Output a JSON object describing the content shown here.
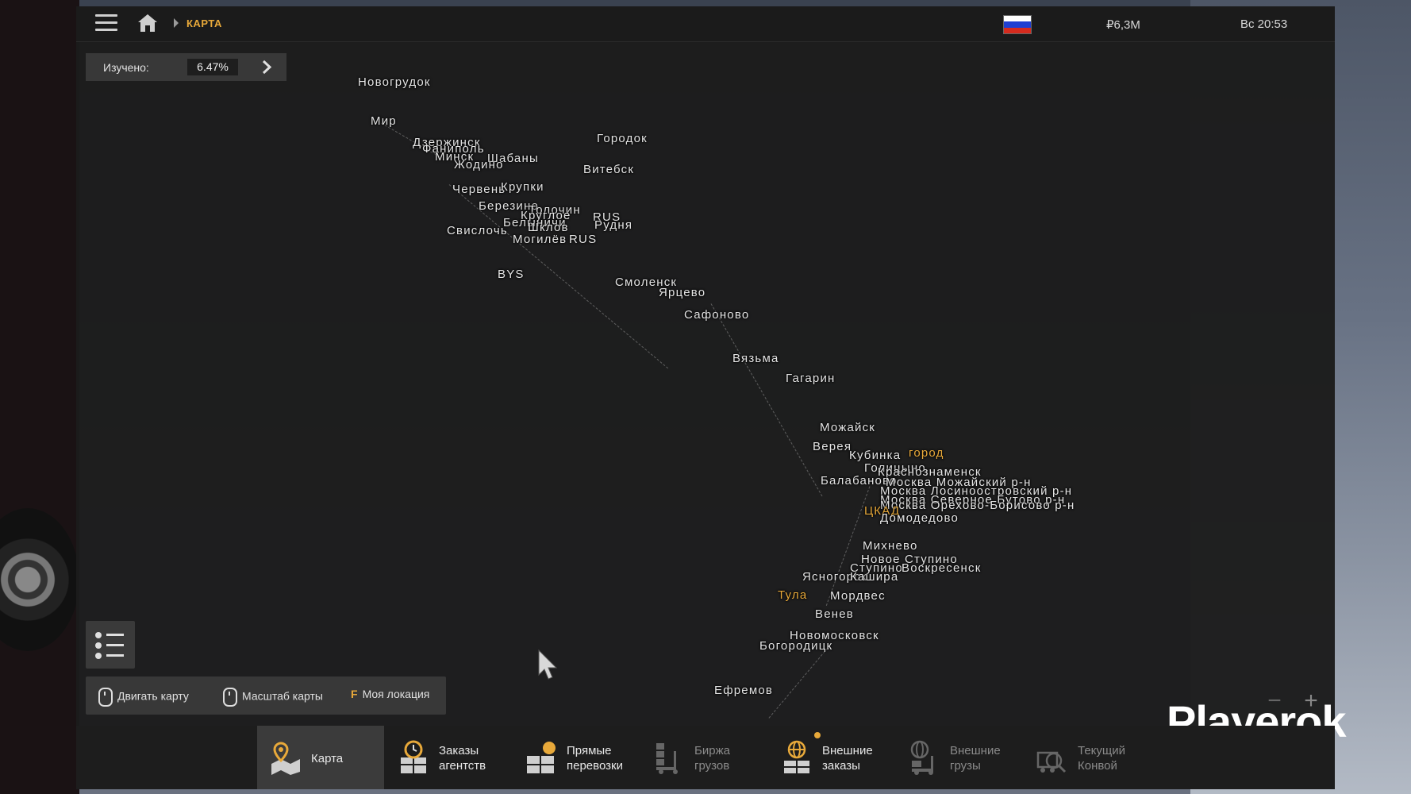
{
  "topbar": {
    "breadcrumb": "КАРТА",
    "money": "₽6,3M",
    "time": "Вс 20:53",
    "flag_colors": [
      "#ffffff",
      "#1f3fd1",
      "#d52b1e"
    ]
  },
  "explored": {
    "label": "Изучено:",
    "value": "6.47%"
  },
  "map_labels": [
    "Новогрудок",
    "Мир",
    "Дзержинск",
    "Фаниполь",
    "Минск",
    "Шабаны",
    "Жодино",
    "Городок",
    "Витебск",
    "Червень",
    "Крупки",
    "Березино",
    "Толочин",
    "Круглое",
    "RUS",
    "Белыничи",
    "Шклов",
    "Рудня",
    "Свислочь",
    "Могилёв",
    "RUS",
    "BYS",
    "Смоленск",
    "Ярцево",
    "Сафоново",
    "Вязьма",
    "Гагарин",
    "Можайск",
    "Верея",
    "Кубинка",
    "город",
    "Голицыно",
    "Краснознаменск",
    "Балабаново",
    "Москва Можайский р-н",
    "Москва Лосиноостровский р-н",
    "Москва Северное Бутово р-н",
    "Москва Орехово-Борисово р-н",
    "ЦКАД",
    "Домодедово",
    "Михнево",
    "Новое Ступино",
    "Ступино",
    "Воскресенск",
    "Ясногорск",
    "Кашира",
    "Тула",
    "Мордвес",
    "Венев",
    "Новомосковск",
    "Богородицк",
    "Ефремов"
  ],
  "hints": {
    "move": "Двигать карту",
    "scale": "Масштаб карты",
    "loc_key": "F",
    "loc": "Моя локация"
  },
  "zoom": {
    "out": "−",
    "in": "+"
  },
  "watermark": "Playerok",
  "tabs": [
    {
      "label": "Карта"
    },
    {
      "label1": "Заказы",
      "label2": "агентств"
    },
    {
      "label1": "Прямые",
      "label2": "перевозки"
    },
    {
      "label1": "Биржа",
      "label2": "грузов"
    },
    {
      "label1": "Внешние",
      "label2": "заказы"
    },
    {
      "label1": "Внешние",
      "label2": "грузы"
    },
    {
      "label1": "Текущий",
      "label2": "Конвой"
    }
  ],
  "accent_color": "#e8a93a"
}
